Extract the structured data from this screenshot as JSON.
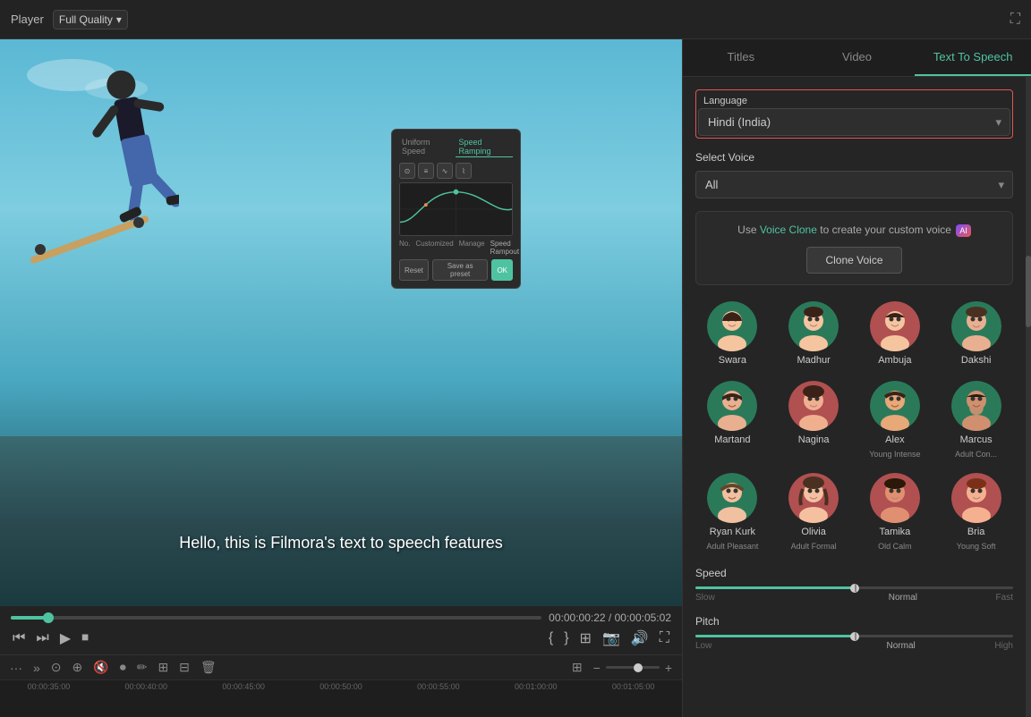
{
  "topbar": {
    "player_label": "Player",
    "quality_label": "Full Quality",
    "chevron": "▾"
  },
  "tabs": {
    "titles_label": "Titles",
    "video_label": "Video",
    "tts_label": "Text To Speech"
  },
  "tts": {
    "language_label": "Language",
    "language_value": "Hindi (India)",
    "select_voice_label": "Select Voice",
    "select_voice_value": "All",
    "voice_clone_text": "Use",
    "voice_clone_link": "Voice Clone",
    "voice_clone_rest": " to create your custom voice",
    "clone_btn_label": "Clone Voice",
    "voices": [
      {
        "id": "swara",
        "name": "Swara",
        "subtitle": "",
        "avatar_class": "avatar-swara",
        "emoji": "👩"
      },
      {
        "id": "madhur",
        "name": "Madhur",
        "subtitle": "",
        "avatar_class": "avatar-madhur",
        "emoji": "👩"
      },
      {
        "id": "ambuja",
        "name": "Ambuja",
        "subtitle": "",
        "avatar_class": "avatar-ambuja",
        "emoji": "👩"
      },
      {
        "id": "dakshi",
        "name": "Dakshi",
        "subtitle": "",
        "avatar_class": "avatar-dakshi",
        "emoji": "👩"
      },
      {
        "id": "martand",
        "name": "Martand",
        "subtitle": "",
        "avatar_class": "avatar-martand",
        "emoji": "🧑"
      },
      {
        "id": "nagina",
        "name": "Nagina",
        "subtitle": "",
        "avatar_class": "avatar-nagina",
        "emoji": "👩"
      },
      {
        "id": "alex",
        "name": "Alex",
        "subtitle": "Young Intense",
        "avatar_class": "avatar-alex",
        "emoji": "🧑"
      },
      {
        "id": "marcus",
        "name": "Marcus",
        "subtitle": "Adult Con...",
        "avatar_class": "avatar-marcus",
        "emoji": "🧑"
      },
      {
        "id": "ryan_kurk",
        "name": "Ryan Kurk",
        "subtitle": "Adult Pleasant",
        "avatar_class": "avatar-ryan",
        "emoji": "🧑"
      },
      {
        "id": "olivia",
        "name": "Olivia",
        "subtitle": "Adult Formal",
        "avatar_class": "avatar-olivia",
        "emoji": "👩"
      },
      {
        "id": "tamika",
        "name": "Tamika",
        "subtitle": "Old Calm",
        "avatar_class": "avatar-tamika",
        "emoji": "👩"
      },
      {
        "id": "bria",
        "name": "Bria",
        "subtitle": "Young Soft",
        "avatar_class": "avatar-bria",
        "emoji": "👩"
      }
    ],
    "speed_label": "Speed",
    "speed_slow": "Slow",
    "speed_normal": "Normal",
    "speed_fast": "Fast",
    "speed_value_pct": 50,
    "speed_normal_pct": 50,
    "pitch_label": "Pitch",
    "pitch_low": "Low",
    "pitch_normal": "Normal",
    "pitch_high": "High",
    "pitch_value_pct": 50,
    "pitch_normal_pct": 50
  },
  "video": {
    "subtitle": "Hello, this is Filmora's text to speech features",
    "current_time": "00:00:00:22",
    "total_time": "00:00:05:02",
    "popup": {
      "tab1": "Uniform Speed",
      "tab2": "Speed Ramping",
      "reset_btn": "Reset",
      "save_btn": "Save as preset",
      "ok_btn": "OK"
    }
  },
  "timeline": {
    "ticks": [
      "00:00:35:00",
      "00:00:40:00",
      "00:00:45:00",
      "00:00:50:00",
      "00:00:55:00",
      "00:01:00:00",
      "00:01:05:00"
    ]
  }
}
